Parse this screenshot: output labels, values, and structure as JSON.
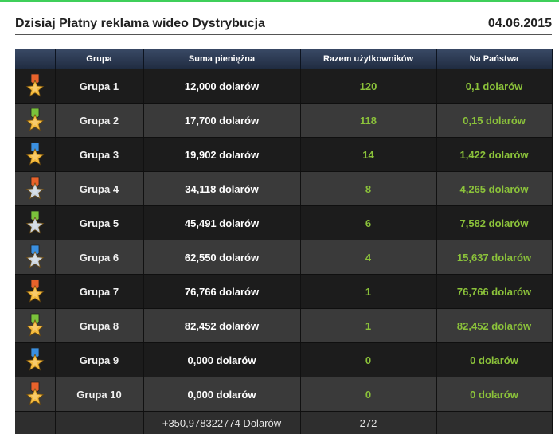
{
  "header": {
    "title": "Dzisiaj Płatny reklama wideo Dystrybucja",
    "date": "04.06.2015"
  },
  "table": {
    "columns": [
      "",
      "Grupa",
      "Suma pieniężna",
      "Razem użytkowników",
      "Na Państwa"
    ],
    "group_prefix": "Grupa",
    "rows": [
      {
        "medal": "orange-ribbon-gold-star-icon",
        "ribbon": "#e8622b",
        "star": "#f4b93a",
        "group": "1",
        "sum": "12,000 dolarów",
        "users": "120",
        "per": "0,1 dolarów"
      },
      {
        "medal": "green-ribbon-gold-star-icon",
        "ribbon": "#7ac23b",
        "star": "#f4b93a",
        "group": "2",
        "sum": "17,700 dolarów",
        "users": "118",
        "per": "0,15 dolarów"
      },
      {
        "medal": "blue-ribbon-gold-star-icon",
        "ribbon": "#3a8fe0",
        "star": "#f4b93a",
        "group": "3",
        "sum": "19,902 dolarów",
        "users": "14",
        "per": "1,422 dolarów"
      },
      {
        "medal": "orange-ribbon-silver-star-icon",
        "ribbon": "#e8622b",
        "star": "#c9d3de",
        "group": "4",
        "sum": "34,118 dolarów",
        "users": "8",
        "per": "4,265 dolarów"
      },
      {
        "medal": "green-ribbon-silver-star-icon",
        "ribbon": "#7ac23b",
        "star": "#c9d3de",
        "group": "5",
        "sum": "45,491 dolarów",
        "users": "6",
        "per": "7,582 dolarów"
      },
      {
        "medal": "blue-ribbon-silver-star-icon",
        "ribbon": "#3a8fe0",
        "star": "#c9d3de",
        "group": "6",
        "sum": "62,550 dolarów",
        "users": "4",
        "per": "15,637 dolarów"
      },
      {
        "medal": "orange-ribbon-gold-star-icon",
        "ribbon": "#e8622b",
        "star": "#f4b93a",
        "group": "7",
        "sum": "76,766 dolarów",
        "users": "1",
        "per": "76,766 dolarów"
      },
      {
        "medal": "green-ribbon-gold-star-icon",
        "ribbon": "#7ac23b",
        "star": "#f4b93a",
        "group": "8",
        "sum": "82,452 dolarów",
        "users": "1",
        "per": "82,452 dolarów"
      },
      {
        "medal": "blue-ribbon-gold-star-icon",
        "ribbon": "#3a8fe0",
        "star": "#f4b93a",
        "group": "9",
        "sum": "0,000 dolarów",
        "users": "0",
        "per": "0 dolarów"
      },
      {
        "medal": "orange-ribbon-gold-star-icon",
        "ribbon": "#e8622b",
        "star": "#f4b93a",
        "group": "10",
        "sum": "0,000 dolarów",
        "users": "0",
        "per": "0 dolarów"
      }
    ],
    "footer": {
      "total_sum": "+350,978322774 Dolarów",
      "total_users": "272"
    }
  },
  "colors": {
    "accent_green": "#8bc23a",
    "top_line": "#3fcf5a"
  }
}
